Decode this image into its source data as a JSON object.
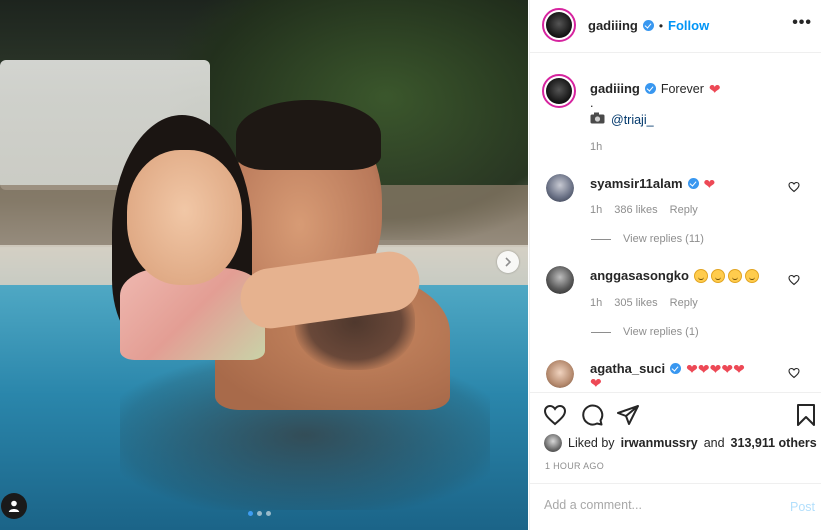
{
  "post": {
    "photo_alt": "",
    "carousel": {
      "count": 3,
      "active_index": 0
    },
    "next_icon": "chevron-right-icon",
    "tag_icon": "user-tag-icon"
  },
  "header": {
    "username": "gadiiing",
    "separator": "•",
    "follow_label": "Follow",
    "more_label": "•••"
  },
  "caption": {
    "username": "gadiiing",
    "text": "Forever",
    "line2": ".",
    "camera_icon": "camera-icon",
    "credit": "@triaji_",
    "time": "1h"
  },
  "comments": [
    {
      "username": "syamsir11alam",
      "text": "",
      "time": "1h",
      "likes": "386 likes",
      "reply_label": "Reply",
      "view_replies": "View replies (11)"
    },
    {
      "username": "anggasasongko",
      "text": "",
      "time": "1h",
      "likes": "305 likes",
      "reply_label": "Reply",
      "view_replies": "View replies (1)"
    },
    {
      "username": "agatha_suci",
      "text": ""
    }
  ],
  "likes": {
    "prefix": "Liked by",
    "user": "irwanmussry",
    "middle": "and",
    "others": "313,911 others"
  },
  "time_ago": "1 HOUR AGO",
  "add_comment": {
    "placeholder": "Add a comment...",
    "post_label": "Post"
  },
  "colors": {
    "accent": "#0095f6",
    "heart": "#ed4956",
    "verified": "#3897f0"
  }
}
